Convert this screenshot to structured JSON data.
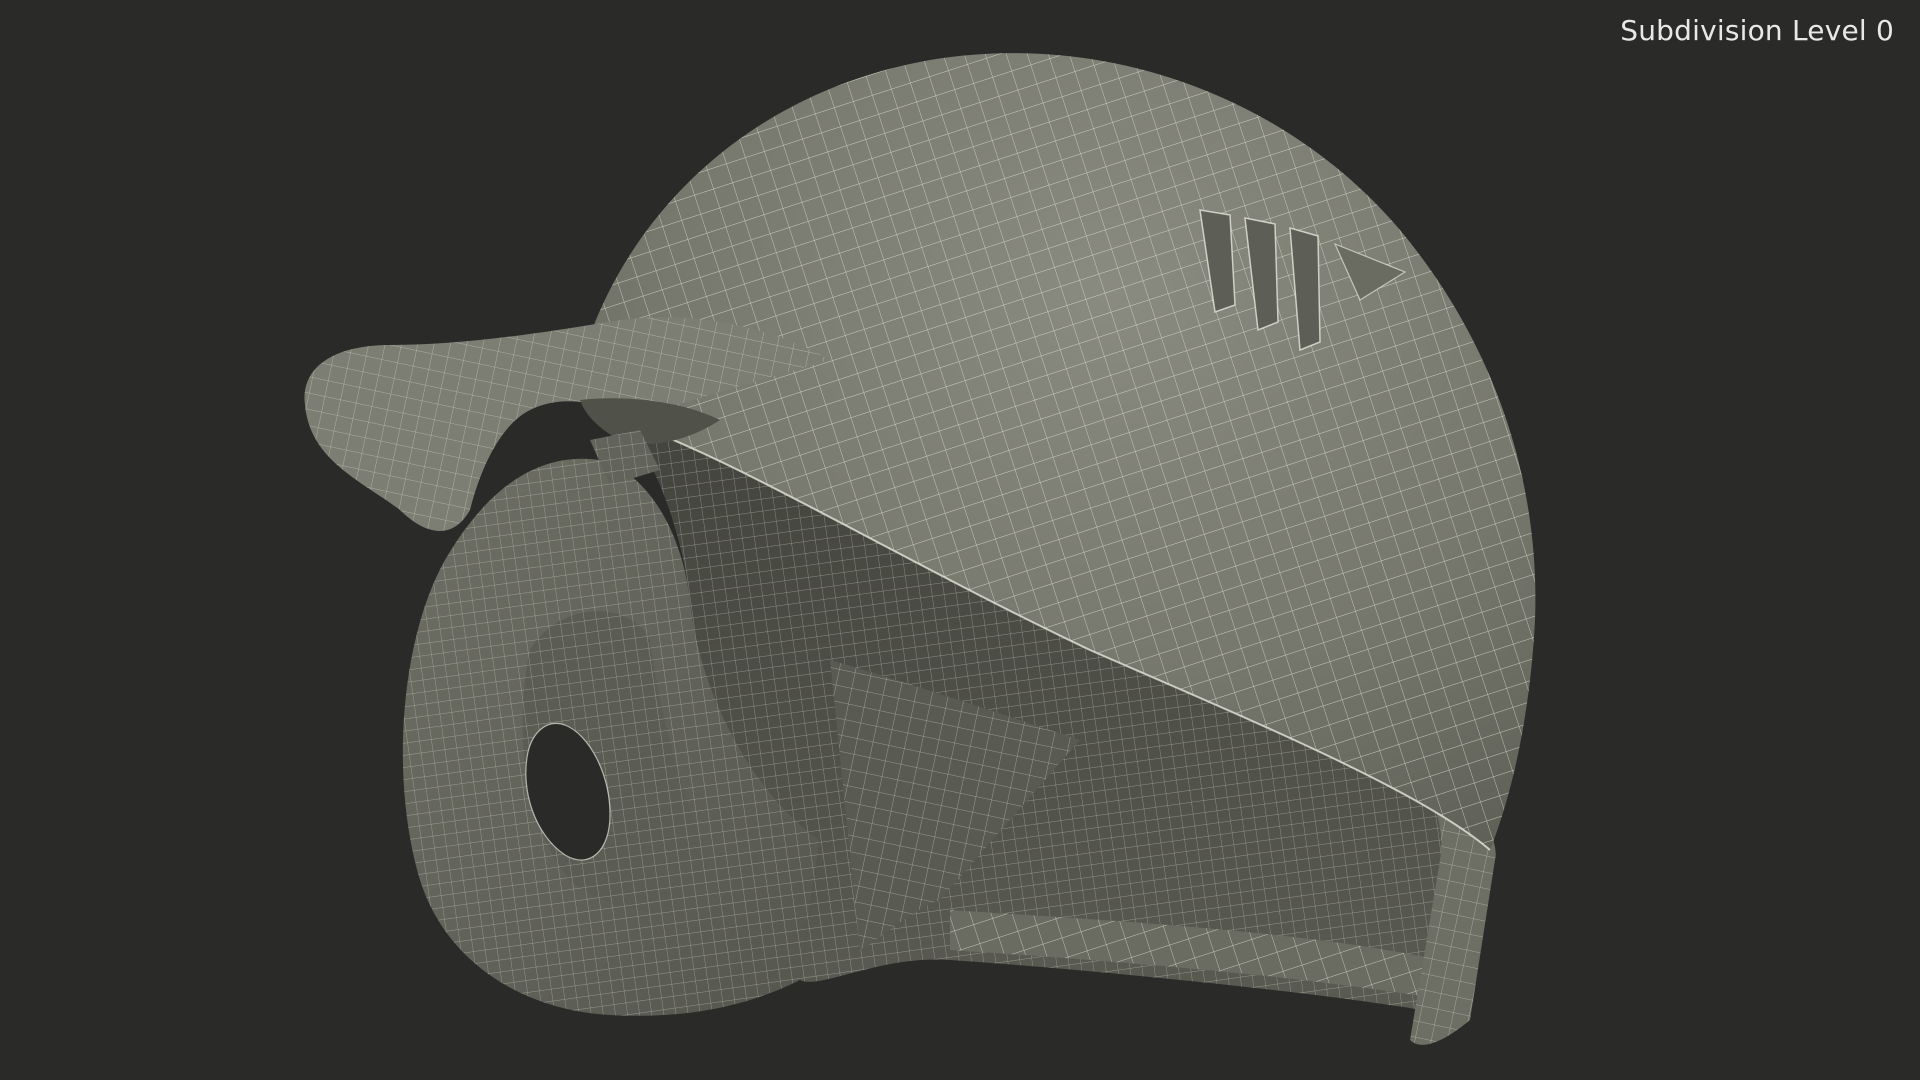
{
  "viewport": {
    "overlay_label": "Subdivision Level 0",
    "background_color": "#2a2a29"
  },
  "model": {
    "object": "helmet",
    "shell_color": "#78796e",
    "interior_color": "#4e4f47",
    "wire_color": "#e6e6dc"
  }
}
